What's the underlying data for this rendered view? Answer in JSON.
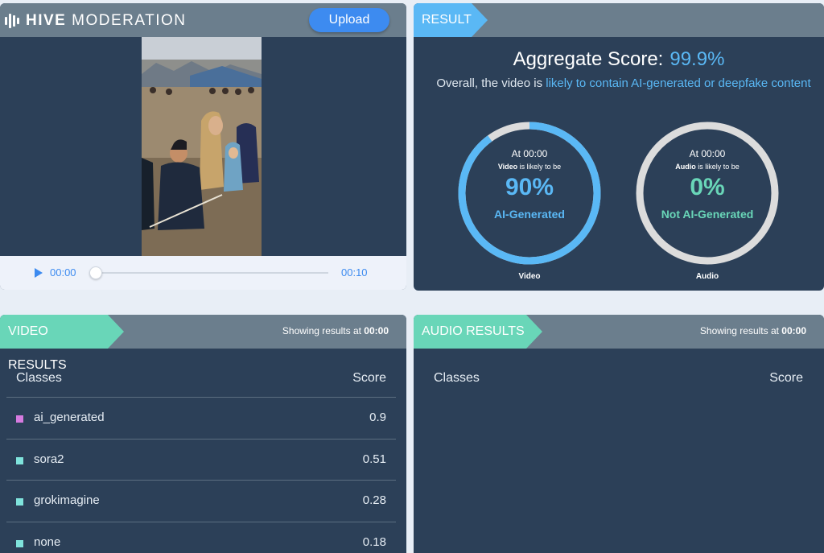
{
  "app": {
    "logo_bold": "HIVE",
    "logo_rest": " MODERATION",
    "upload_label": "Upload"
  },
  "player": {
    "current_time": "00:00",
    "end_time": "00:10",
    "progress": 0
  },
  "result": {
    "tag": "RESULT",
    "aggregate_label": "Aggregate Score:",
    "aggregate_value": "99.9%",
    "overall_prefix": "Overall, the video is ",
    "overall_highlight": "likely to contain AI-generated or deepfake content",
    "video_gauge": {
      "at": "At 00:00",
      "subject": "Video",
      "likely": " is likely to be",
      "percent": "90%",
      "value": 0.9,
      "verdict": "AI-Generated",
      "caption": "Video",
      "color": "#5ab8f5"
    },
    "audio_gauge": {
      "at": "At 00:00",
      "subject": "Audio",
      "likely": " is likely to be",
      "percent": "0%",
      "value": 0,
      "verdict": "Not AI-Generated",
      "caption": "Audio",
      "color": "#69d6b8"
    }
  },
  "video_results": {
    "tag": "VIDEO RESULTS",
    "showing_prefix": "Showing results at ",
    "showing_time": "00:00",
    "col_classes": "Classes",
    "col_score": "Score",
    "rows": [
      {
        "name": "ai_generated",
        "score": "0.9",
        "color": "#d67be0"
      },
      {
        "name": "sora2",
        "score": "0.51",
        "color": "#7fe3dc"
      },
      {
        "name": "grokimagine",
        "score": "0.28",
        "color": "#7fe3dc"
      },
      {
        "name": "none",
        "score": "0.18",
        "color": "#7fe3dc"
      }
    ]
  },
  "audio_results": {
    "tag": "AUDIO RESULTS",
    "showing_prefix": "Showing results at ",
    "showing_time": "00:00",
    "col_classes": "Classes",
    "col_score": "Score"
  },
  "colors": {
    "accent_blue": "#5ab8f5",
    "accent_teal": "#69d6b8",
    "panel": "#2c4058",
    "panel_header": "#6b7e8d"
  }
}
